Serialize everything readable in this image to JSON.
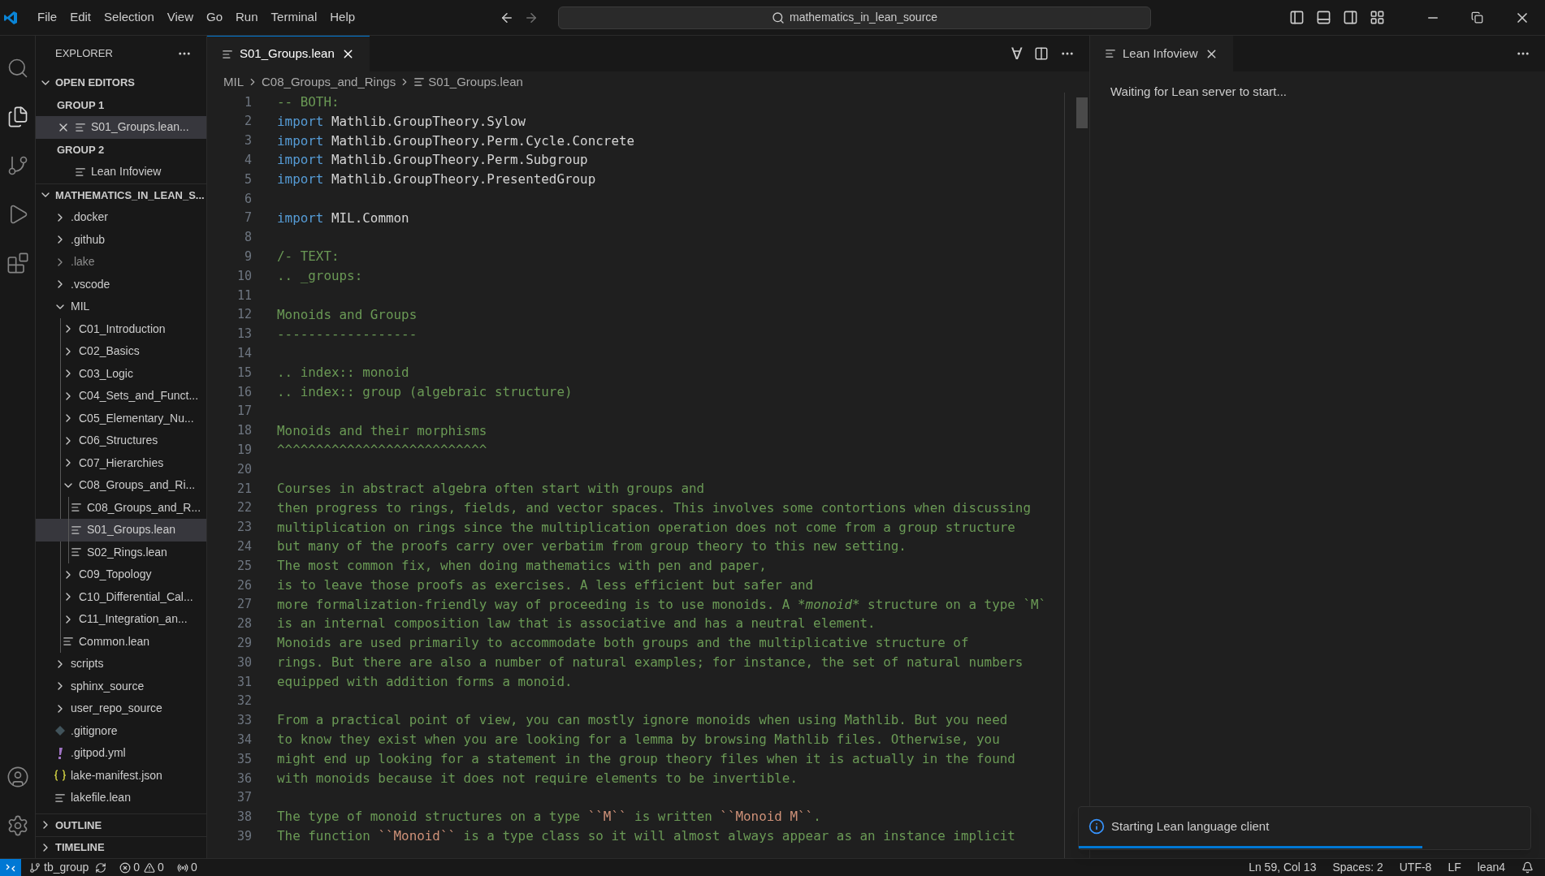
{
  "title_bar": {
    "menu": [
      "File",
      "Edit",
      "Selection",
      "View",
      "Go",
      "Run",
      "Terminal",
      "Help"
    ],
    "search": {
      "value": "mathematics_in_lean_source"
    }
  },
  "activity_bar": [
    {
      "kind": "search",
      "selected": false
    },
    {
      "kind": "explorer",
      "selected": true
    },
    {
      "kind": "source_control",
      "selected": false
    },
    {
      "kind": "run",
      "selected": false
    },
    {
      "kind": "extensions",
      "selected": false
    },
    {
      "kind": "account",
      "selected": false
    },
    {
      "kind": "settings",
      "selected": false
    }
  ],
  "sidebar": {
    "title": "EXPLORER",
    "open_editors": {
      "label": "OPEN EDITORS",
      "expanded": true,
      "groups": [
        {
          "label": "GROUP 1",
          "items": [
            {
              "label": "S01_Groups.lean...",
              "selected": true
            }
          ]
        },
        {
          "label": "GROUP 2",
          "items": [
            {
              "label": "Lean Infoview",
              "selected": false
            }
          ]
        }
      ]
    },
    "folder": {
      "label": "MATHEMATICS_IN_LEAN_S...",
      "expanded": true,
      "children": [
        {
          "label": ".docker",
          "kind": "folder",
          "expanded": false,
          "selected": false,
          "dimmed": false
        },
        {
          "label": ".github",
          "kind": "folder",
          "expanded": false,
          "selected": false,
          "dimmed": false
        },
        {
          "label": ".lake",
          "kind": "folder",
          "expanded": false,
          "selected": false,
          "dimmed": true
        },
        {
          "label": ".vscode",
          "kind": "folder",
          "expanded": false,
          "selected": false,
          "dimmed": false
        },
        {
          "label": "MIL",
          "kind": "folder",
          "expanded": true,
          "selected": false,
          "dimmed": false,
          "children": [
            {
              "label": "C01_Introduction",
              "kind": "folder",
              "expanded": false,
              "selected": false,
              "dimmed": false
            },
            {
              "label": "C02_Basics",
              "kind": "folder",
              "expanded": false,
              "selected": false,
              "dimmed": false
            },
            {
              "label": "C03_Logic",
              "kind": "folder",
              "expanded": false,
              "selected": false,
              "dimmed": false
            },
            {
              "label": "C04_Sets_and_Funct...",
              "kind": "folder",
              "expanded": false,
              "selected": false,
              "dimmed": false
            },
            {
              "label": "C05_Elementary_Nu...",
              "kind": "folder",
              "expanded": false,
              "selected": false,
              "dimmed": false
            },
            {
              "label": "C06_Structures",
              "kind": "folder",
              "expanded": false,
              "selected": false,
              "dimmed": false
            },
            {
              "label": "C07_Hierarchies",
              "kind": "folder",
              "expanded": false,
              "selected": false,
              "dimmed": false
            },
            {
              "label": "C08_Groups_and_Ri...",
              "kind": "folder",
              "expanded": true,
              "selected": false,
              "dimmed": false,
              "children": [
                {
                  "label": "C08_Groups_and_R...",
                  "kind": "lean",
                  "selected": false,
                  "dimmed": false
                },
                {
                  "label": "S01_Groups.lean",
                  "kind": "lean",
                  "selected": true,
                  "dimmed": false
                },
                {
                  "label": "S02_Rings.lean",
                  "kind": "lean",
                  "selected": false,
                  "dimmed": false
                }
              ]
            },
            {
              "label": "C09_Topology",
              "kind": "folder",
              "expanded": false,
              "selected": false,
              "dimmed": false
            },
            {
              "label": "C10_Differential_Cal...",
              "kind": "folder",
              "expanded": false,
              "selected": false,
              "dimmed": false
            },
            {
              "label": "C11_Integration_an...",
              "kind": "folder",
              "expanded": false,
              "selected": false,
              "dimmed": false
            },
            {
              "label": "Common.lean",
              "kind": "lean",
              "selected": false,
              "dimmed": false
            }
          ]
        },
        {
          "label": "scripts",
          "kind": "folder",
          "expanded": false,
          "selected": false,
          "dimmed": false
        },
        {
          "label": "sphinx_source",
          "kind": "folder",
          "expanded": false,
          "selected": false,
          "dimmed": false
        },
        {
          "label": "user_repo_source",
          "kind": "folder",
          "expanded": false,
          "selected": false,
          "dimmed": false
        },
        {
          "label": ".gitignore",
          "kind": "git",
          "selected": false,
          "dimmed": false
        },
        {
          "label": ".gitpod.yml",
          "kind": "yaml",
          "selected": false,
          "dimmed": false
        },
        {
          "label": "lake-manifest.json",
          "kind": "json",
          "selected": false,
          "dimmed": false
        },
        {
          "label": "lakefile.lean",
          "kind": "lean",
          "selected": false,
          "dimmed": false
        }
      ]
    },
    "sections": [
      {
        "label": "OUTLINE",
        "expanded": false
      },
      {
        "label": "TIMELINE",
        "expanded": false
      }
    ]
  },
  "editor": {
    "tabs": [
      {
        "label": "S01_Groups.lean",
        "selected": true
      }
    ],
    "actions": [
      {
        "kind": "glyph",
        "text": "∀"
      },
      {
        "kind": "split"
      },
      {
        "kind": "more"
      }
    ],
    "breadcrumb": [
      "MIL",
      "C08_Groups_and_Rings",
      "S01_Groups.lean"
    ],
    "lines": [
      {
        "number": "1",
        "segments": [
          {
            "kind": "comment",
            "text": "-- BOTH:"
          }
        ]
      },
      {
        "number": "2",
        "segments": [
          {
            "kind": "keyword",
            "text": "import"
          },
          {
            "kind": "text",
            "text": " Mathlib.GroupTheory.Sylow"
          }
        ]
      },
      {
        "number": "3",
        "segments": [
          {
            "kind": "keyword",
            "text": "import"
          },
          {
            "kind": "text",
            "text": " Mathlib.GroupTheory.Perm.Cycle.Concrete"
          }
        ]
      },
      {
        "number": "4",
        "segments": [
          {
            "kind": "keyword",
            "text": "import"
          },
          {
            "kind": "text",
            "text": " Mathlib.GroupTheory.Perm.Subgroup"
          }
        ]
      },
      {
        "number": "5",
        "segments": [
          {
            "kind": "keyword",
            "text": "import"
          },
          {
            "kind": "text",
            "text": " Mathlib.GroupTheory.PresentedGroup"
          }
        ]
      },
      {
        "number": "6"
      },
      {
        "number": "7",
        "segments": [
          {
            "kind": "keyword",
            "text": "import"
          },
          {
            "kind": "text",
            "text": " MIL.Common"
          }
        ]
      },
      {
        "number": "8"
      },
      {
        "number": "9",
        "segments": [
          {
            "kind": "comment",
            "text": "/- TEXT:"
          }
        ]
      },
      {
        "number": "10",
        "segments": [
          {
            "kind": "comment",
            "text": ".. _groups:"
          }
        ]
      },
      {
        "number": "11"
      },
      {
        "number": "12",
        "segments": [
          {
            "kind": "comment",
            "text": "Monoids and Groups"
          }
        ]
      },
      {
        "number": "13",
        "segments": [
          {
            "kind": "comment",
            "text": "------------------"
          }
        ]
      },
      {
        "number": "14"
      },
      {
        "number": "15",
        "segments": [
          {
            "kind": "comment",
            "text": ".. index:: monoid"
          }
        ]
      },
      {
        "number": "16",
        "segments": [
          {
            "kind": "comment",
            "text": ".. index:: group (algebraic structure)"
          }
        ]
      },
      {
        "number": "17"
      },
      {
        "number": "18",
        "segments": [
          {
            "kind": "comment",
            "text": "Monoids and their morphisms"
          }
        ]
      },
      {
        "number": "19",
        "segments": [
          {
            "kind": "comment",
            "text": "^^^^^^^^^^^^^^^^^^^^^^^^^^^"
          }
        ]
      },
      {
        "number": "20"
      },
      {
        "number": "21",
        "segments": [
          {
            "kind": "comment",
            "text": "Courses in abstract algebra often start with groups and"
          }
        ]
      },
      {
        "number": "22",
        "segments": [
          {
            "kind": "comment",
            "text": "then progress to rings, fields, and vector spaces. This involves some contortions when discussing"
          }
        ]
      },
      {
        "number": "23",
        "segments": [
          {
            "kind": "comment",
            "text": "multiplication on rings since the multiplication operation does not come from a group structure"
          }
        ]
      },
      {
        "number": "24",
        "segments": [
          {
            "kind": "comment",
            "text": "but many of the proofs carry over verbatim from group theory to this new setting."
          }
        ]
      },
      {
        "number": "25",
        "segments": [
          {
            "kind": "comment",
            "text": "The most common fix, when doing mathematics with pen and paper,"
          }
        ]
      },
      {
        "number": "26",
        "segments": [
          {
            "kind": "comment",
            "text": "is to leave those proofs as exercises. A less efficient but safer and"
          }
        ]
      },
      {
        "number": "27",
        "segments": [
          {
            "kind": "comment",
            "text": "more formalization-friendly way of proceeding is to use monoids. A "
          },
          {
            "kind": "emphasis",
            "text": "*monoid*"
          },
          {
            "kind": "comment",
            "text": " structure on a type `M`"
          }
        ]
      },
      {
        "number": "28",
        "segments": [
          {
            "kind": "comment",
            "text": "is an internal composition law that is associative and has a neutral element."
          }
        ]
      },
      {
        "number": "29",
        "segments": [
          {
            "kind": "comment",
            "text": "Monoids are used primarily to accommodate both groups and the multiplicative structure of"
          }
        ]
      },
      {
        "number": "30",
        "segments": [
          {
            "kind": "comment",
            "text": "rings. But there are also a number of natural examples; for instance, the set of natural numbers"
          }
        ]
      },
      {
        "number": "31",
        "segments": [
          {
            "kind": "comment",
            "text": "equipped with addition forms a monoid."
          }
        ]
      },
      {
        "number": "32"
      },
      {
        "number": "33",
        "segments": [
          {
            "kind": "comment",
            "text": "From a practical point of view, you can mostly ignore monoids when using Mathlib. But you need"
          }
        ]
      },
      {
        "number": "34",
        "segments": [
          {
            "kind": "comment",
            "text": "to know they exist when you are looking for a lemma by browsing Mathlib files. Otherwise, you"
          }
        ]
      },
      {
        "number": "35",
        "segments": [
          {
            "kind": "comment",
            "text": "might end up looking for a statement in the group theory files when it is actually in the found"
          }
        ]
      },
      {
        "number": "36",
        "segments": [
          {
            "kind": "comment",
            "text": "with monoids because it does not require elements to be invertible."
          }
        ]
      },
      {
        "number": "37"
      },
      {
        "number": "38",
        "segments": [
          {
            "kind": "comment",
            "text": "The type of monoid structures on a type "
          },
          {
            "kind": "literal",
            "text": "``M``"
          },
          {
            "kind": "comment",
            "text": " is written "
          },
          {
            "kind": "literal",
            "text": "``Monoid M``"
          },
          {
            "kind": "comment",
            "text": "."
          }
        ]
      },
      {
        "number": "39",
        "segments": [
          {
            "kind": "comment",
            "text": "The function "
          },
          {
            "kind": "literal",
            "text": "``Monoid``"
          },
          {
            "kind": "comment",
            "text": " is a type class so it will almost always appear as an instance implicit"
          }
        ]
      }
    ]
  },
  "infoview": {
    "tab": {
      "label": "Lean Infoview",
      "selected": true
    },
    "message": "Waiting for Lean server to start..."
  },
  "notification": {
    "message": "Starting Lean language client",
    "level": 0.76
  },
  "status_bar": {
    "branch": "tb_group",
    "errors": "0",
    "warnings": "0",
    "ports": "0",
    "right": [
      "Ln 59, Col 13",
      "Spaces: 2",
      "UTF-8",
      "LF",
      "lean4"
    ]
  }
}
